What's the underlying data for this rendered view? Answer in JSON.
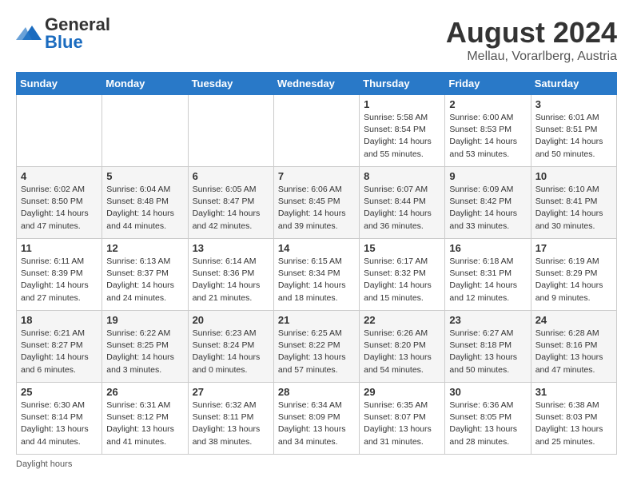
{
  "logo": {
    "general": "General",
    "blue": "Blue"
  },
  "header": {
    "month_year": "August 2024",
    "location": "Mellau, Vorarlberg, Austria"
  },
  "days_of_week": [
    "Sunday",
    "Monday",
    "Tuesday",
    "Wednesday",
    "Thursday",
    "Friday",
    "Saturday"
  ],
  "footer": {
    "note": "Daylight hours"
  },
  "weeks": [
    [
      {
        "day": "",
        "info": ""
      },
      {
        "day": "",
        "info": ""
      },
      {
        "day": "",
        "info": ""
      },
      {
        "day": "",
        "info": ""
      },
      {
        "day": "1",
        "info": "Sunrise: 5:58 AM\nSunset: 8:54 PM\nDaylight: 14 hours\nand 55 minutes."
      },
      {
        "day": "2",
        "info": "Sunrise: 6:00 AM\nSunset: 8:53 PM\nDaylight: 14 hours\nand 53 minutes."
      },
      {
        "day": "3",
        "info": "Sunrise: 6:01 AM\nSunset: 8:51 PM\nDaylight: 14 hours\nand 50 minutes."
      }
    ],
    [
      {
        "day": "4",
        "info": "Sunrise: 6:02 AM\nSunset: 8:50 PM\nDaylight: 14 hours\nand 47 minutes."
      },
      {
        "day": "5",
        "info": "Sunrise: 6:04 AM\nSunset: 8:48 PM\nDaylight: 14 hours\nand 44 minutes."
      },
      {
        "day": "6",
        "info": "Sunrise: 6:05 AM\nSunset: 8:47 PM\nDaylight: 14 hours\nand 42 minutes."
      },
      {
        "day": "7",
        "info": "Sunrise: 6:06 AM\nSunset: 8:45 PM\nDaylight: 14 hours\nand 39 minutes."
      },
      {
        "day": "8",
        "info": "Sunrise: 6:07 AM\nSunset: 8:44 PM\nDaylight: 14 hours\nand 36 minutes."
      },
      {
        "day": "9",
        "info": "Sunrise: 6:09 AM\nSunset: 8:42 PM\nDaylight: 14 hours\nand 33 minutes."
      },
      {
        "day": "10",
        "info": "Sunrise: 6:10 AM\nSunset: 8:41 PM\nDaylight: 14 hours\nand 30 minutes."
      }
    ],
    [
      {
        "day": "11",
        "info": "Sunrise: 6:11 AM\nSunset: 8:39 PM\nDaylight: 14 hours\nand 27 minutes."
      },
      {
        "day": "12",
        "info": "Sunrise: 6:13 AM\nSunset: 8:37 PM\nDaylight: 14 hours\nand 24 minutes."
      },
      {
        "day": "13",
        "info": "Sunrise: 6:14 AM\nSunset: 8:36 PM\nDaylight: 14 hours\nand 21 minutes."
      },
      {
        "day": "14",
        "info": "Sunrise: 6:15 AM\nSunset: 8:34 PM\nDaylight: 14 hours\nand 18 minutes."
      },
      {
        "day": "15",
        "info": "Sunrise: 6:17 AM\nSunset: 8:32 PM\nDaylight: 14 hours\nand 15 minutes."
      },
      {
        "day": "16",
        "info": "Sunrise: 6:18 AM\nSunset: 8:31 PM\nDaylight: 14 hours\nand 12 minutes."
      },
      {
        "day": "17",
        "info": "Sunrise: 6:19 AM\nSunset: 8:29 PM\nDaylight: 14 hours\nand 9 minutes."
      }
    ],
    [
      {
        "day": "18",
        "info": "Sunrise: 6:21 AM\nSunset: 8:27 PM\nDaylight: 14 hours\nand 6 minutes."
      },
      {
        "day": "19",
        "info": "Sunrise: 6:22 AM\nSunset: 8:25 PM\nDaylight: 14 hours\nand 3 minutes."
      },
      {
        "day": "20",
        "info": "Sunrise: 6:23 AM\nSunset: 8:24 PM\nDaylight: 14 hours\nand 0 minutes."
      },
      {
        "day": "21",
        "info": "Sunrise: 6:25 AM\nSunset: 8:22 PM\nDaylight: 13 hours\nand 57 minutes."
      },
      {
        "day": "22",
        "info": "Sunrise: 6:26 AM\nSunset: 8:20 PM\nDaylight: 13 hours\nand 54 minutes."
      },
      {
        "day": "23",
        "info": "Sunrise: 6:27 AM\nSunset: 8:18 PM\nDaylight: 13 hours\nand 50 minutes."
      },
      {
        "day": "24",
        "info": "Sunrise: 6:28 AM\nSunset: 8:16 PM\nDaylight: 13 hours\nand 47 minutes."
      }
    ],
    [
      {
        "day": "25",
        "info": "Sunrise: 6:30 AM\nSunset: 8:14 PM\nDaylight: 13 hours\nand 44 minutes."
      },
      {
        "day": "26",
        "info": "Sunrise: 6:31 AM\nSunset: 8:12 PM\nDaylight: 13 hours\nand 41 minutes."
      },
      {
        "day": "27",
        "info": "Sunrise: 6:32 AM\nSunset: 8:11 PM\nDaylight: 13 hours\nand 38 minutes."
      },
      {
        "day": "28",
        "info": "Sunrise: 6:34 AM\nSunset: 8:09 PM\nDaylight: 13 hours\nand 34 minutes."
      },
      {
        "day": "29",
        "info": "Sunrise: 6:35 AM\nSunset: 8:07 PM\nDaylight: 13 hours\nand 31 minutes."
      },
      {
        "day": "30",
        "info": "Sunrise: 6:36 AM\nSunset: 8:05 PM\nDaylight: 13 hours\nand 28 minutes."
      },
      {
        "day": "31",
        "info": "Sunrise: 6:38 AM\nSunset: 8:03 PM\nDaylight: 13 hours\nand 25 minutes."
      }
    ]
  ]
}
